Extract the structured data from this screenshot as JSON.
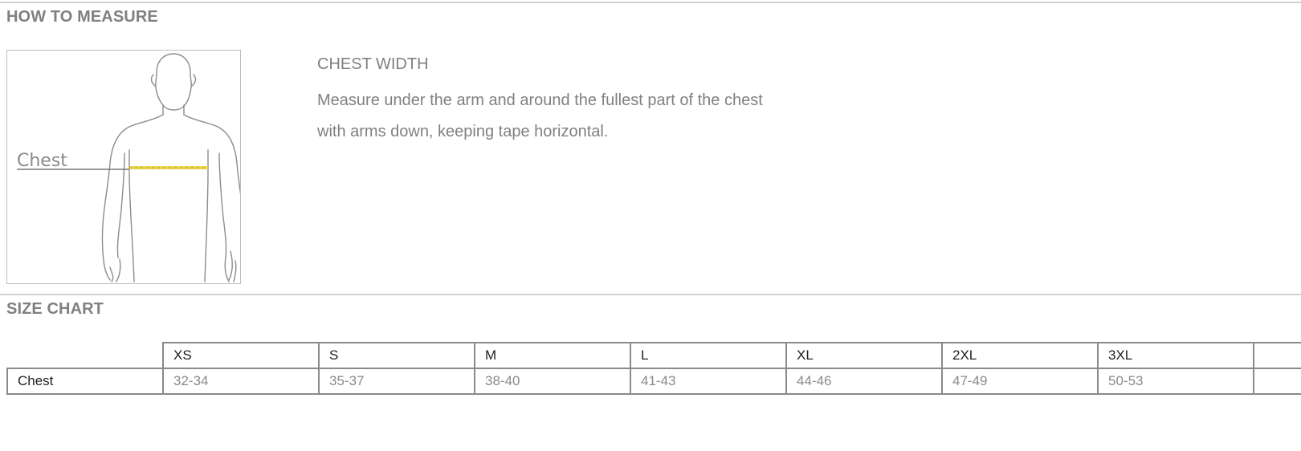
{
  "how_to_measure": {
    "heading": "HOW TO MEASURE",
    "figure_label": "Chest",
    "highlight_color": "#e8d44d",
    "measure_title": "CHEST WIDTH",
    "measure_desc_line1": "Measure under the arm and around the fullest part of the chest",
    "measure_desc_line2": "with arms down, keeping tape horizontal."
  },
  "size_chart": {
    "heading": "SIZE CHART",
    "sizes": [
      "XS",
      "S",
      "M",
      "L",
      "XL",
      "2XL",
      "3XL",
      ""
    ],
    "rows": [
      {
        "label": "Chest",
        "values": [
          "32-34",
          "35-37",
          "38-40",
          "41-43",
          "44-46",
          "47-49",
          "50-53",
          ""
        ]
      }
    ]
  }
}
